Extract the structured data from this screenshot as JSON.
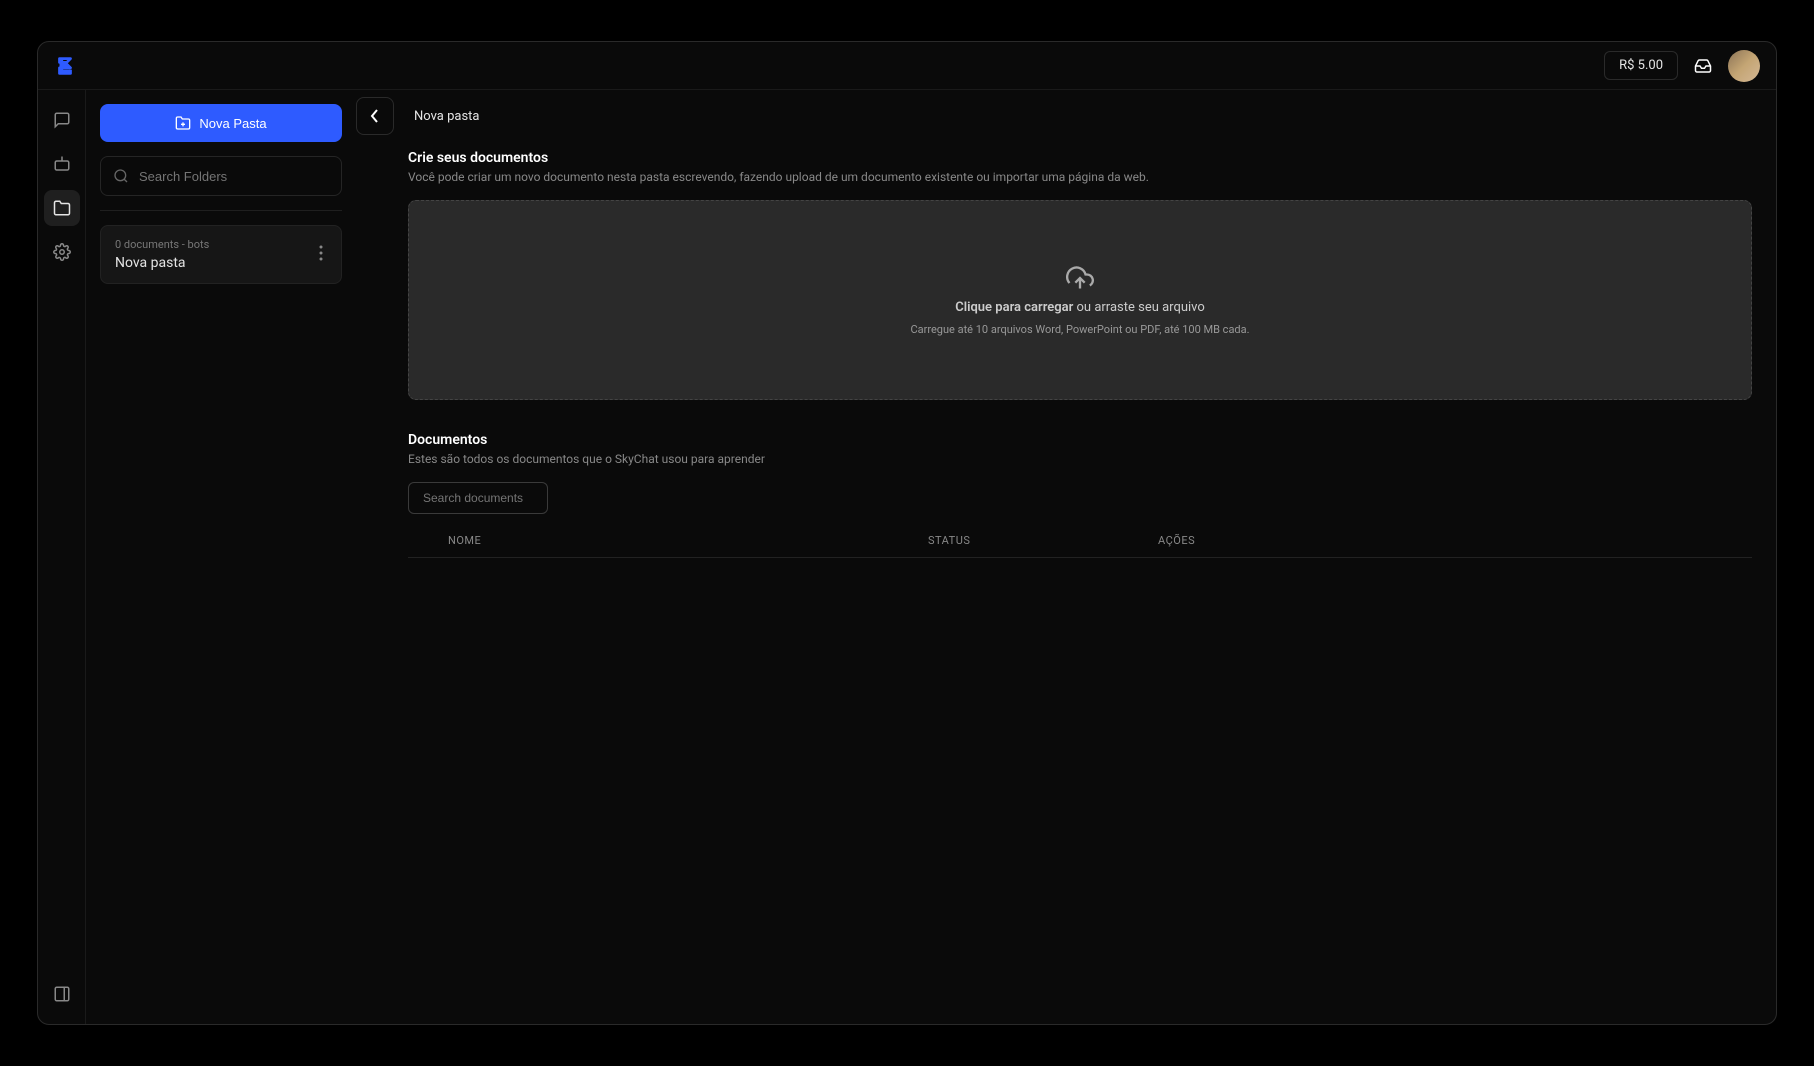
{
  "topbar": {
    "balance": "R$ 5.00"
  },
  "rail": {
    "items": [
      {
        "name": "chat-icon"
      },
      {
        "name": "bot-icon"
      },
      {
        "name": "folder-icon"
      },
      {
        "name": "gear-icon"
      }
    ]
  },
  "sidebar": {
    "new_folder_label": "Nova Pasta",
    "search_placeholder": "Search Folders",
    "folders": [
      {
        "meta": "0 documents - bots",
        "name": "Nova pasta"
      }
    ]
  },
  "content": {
    "breadcrumb": "Nova pasta",
    "create_section": {
      "title": "Crie seus documentos",
      "subtitle": "Você pode criar um novo documento nesta pasta escrevendo, fazendo upload de um documento existente ou importar uma página da web."
    },
    "dropzone": {
      "line1_bold": "Clique para carregar",
      "line1_rest": " ou arraste seu arquivo",
      "line2": "Carregue até 10 arquivos Word, PowerPoint ou PDF, até 100 MB cada."
    },
    "docs_section": {
      "title": "Documentos",
      "subtitle": "Estes são todos os documentos que o SkyChat usou para aprender",
      "search_placeholder": "Search documents"
    },
    "table": {
      "headers": {
        "nome": "NOME",
        "status": "STATUS",
        "acoes": "AÇÕES"
      }
    }
  }
}
